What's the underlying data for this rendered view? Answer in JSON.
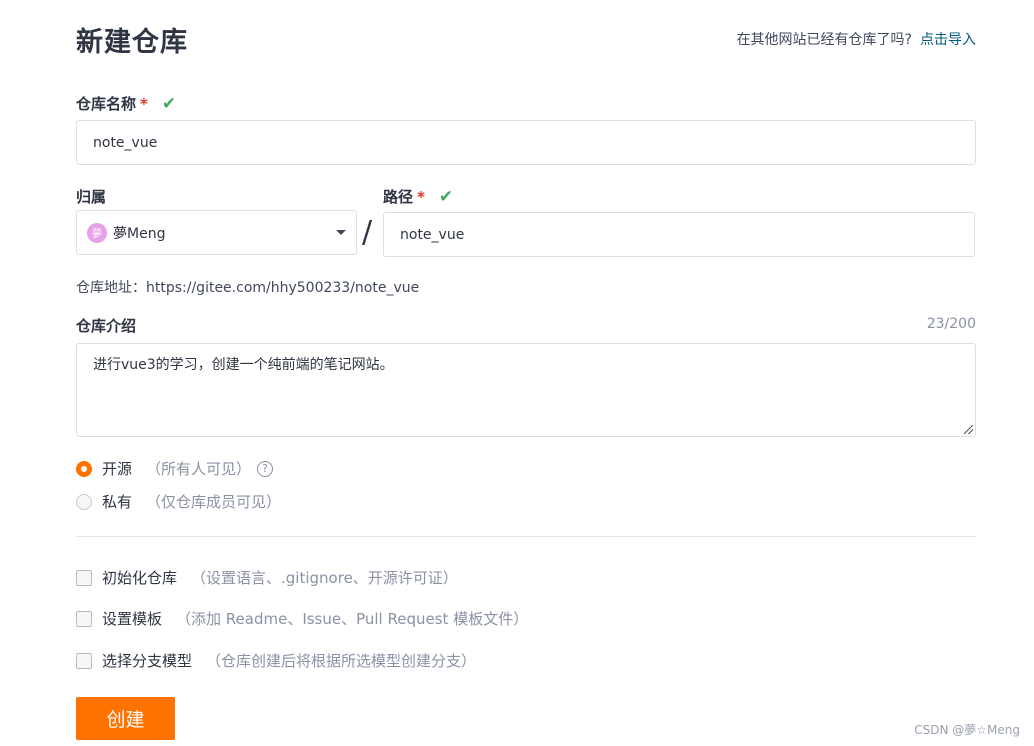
{
  "header": {
    "title": "新建仓库",
    "import_hint": "在其他网站已经有仓库了吗?",
    "import_link": "点击导入"
  },
  "repo_name": {
    "label": "仓库名称",
    "required_mark": "*",
    "value": "note_vue",
    "valid_icon": "check-icon"
  },
  "owner": {
    "label": "归属",
    "avatar_text": "夢",
    "value": "夢Meng"
  },
  "path": {
    "label": "路径",
    "required_mark": "*",
    "separator": "/",
    "value": "note_vue"
  },
  "address": {
    "text": "仓库地址：https://gitee.com/hhy500233/note_vue"
  },
  "description": {
    "label": "仓库介绍",
    "counter": "23/200",
    "value": "进行vue3的学习，创建一个纯前端的笔记网站。"
  },
  "visibility": {
    "options": [
      {
        "label": "开源",
        "hint": "（所有人可见）",
        "selected": true
      },
      {
        "label": "私有",
        "hint": "（仅仓库成员可见）",
        "selected": false
      }
    ],
    "help_glyph": "?"
  },
  "checkboxes": [
    {
      "label": "初始化仓库",
      "hint": "（设置语言、.gitignore、开源许可证）",
      "checked": false
    },
    {
      "label": "设置模板",
      "hint": "（添加 Readme、Issue、Pull Request 模板文件）",
      "checked": false
    },
    {
      "label": "选择分支模型",
      "hint": "（仓库创建后将根据所选模型创建分支）",
      "checked": false
    }
  ],
  "submit": {
    "label": "创建"
  },
  "watermark": "CSDN @夢☆Meng",
  "colors": {
    "accent": "#fe7300",
    "link": "#005980",
    "valid": "#41a85f",
    "required": "#e5332b"
  }
}
